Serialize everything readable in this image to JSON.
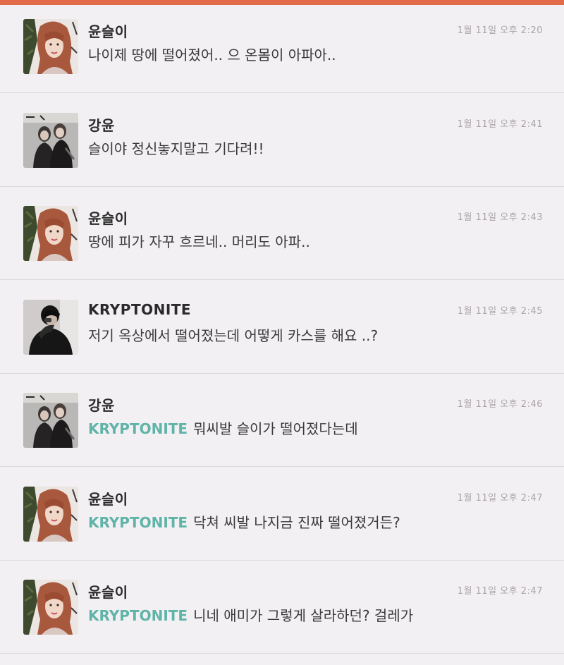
{
  "comments": [
    {
      "author": "윤슬이",
      "avatar": "woman-red-hair-avatar",
      "mention": "",
      "text": "나이제 땅에 떨어졌어.. 으 온몸이 아파아..",
      "time": "1월 11일 오후 2:20"
    },
    {
      "author": "강윤",
      "avatar": "couple-photo-avatar",
      "mention": "",
      "text": "슬이야 정신놓지말고 기다려!!",
      "time": "1월 11일 오후 2:41"
    },
    {
      "author": "윤슬이",
      "avatar": "woman-red-hair-avatar",
      "mention": "",
      "text": "땅에 피가 자꾸 흐르네.. 머리도 아파..",
      "time": "1월 11일 오후 2:43"
    },
    {
      "author": "KRYPTONITE",
      "avatar": "man-dark-photo-avatar",
      "mention": "",
      "text": "저기 옥상에서 떨어졌는데 어떻게 카스를 해요 ..?",
      "time": "1월 11일 오후 2:45"
    },
    {
      "author": "강윤",
      "avatar": "couple-photo-avatar",
      "mention": "KRYPTONITE",
      "text": "뭐씨발 슬이가 떨어졌다는데",
      "time": "1월 11일 오후 2:46"
    },
    {
      "author": "윤슬이",
      "avatar": "woman-red-hair-avatar",
      "mention": "KRYPTONITE",
      "text": "닥쳐 씨발 나지금 진짜 떨어졌거든?",
      "time": "1월 11일 오후 2:47"
    },
    {
      "author": "윤슬이",
      "avatar": "woman-red-hair-avatar",
      "mention": "KRYPTONITE",
      "text": "니네 애미가 그렇게 살라하던? 걸레가",
      "time": "1월 11일 오후 2:47"
    }
  ],
  "colors": {
    "accent_bar": "#e36b4a",
    "mention": "#5fb4a8",
    "background": "#f3f0f3"
  }
}
